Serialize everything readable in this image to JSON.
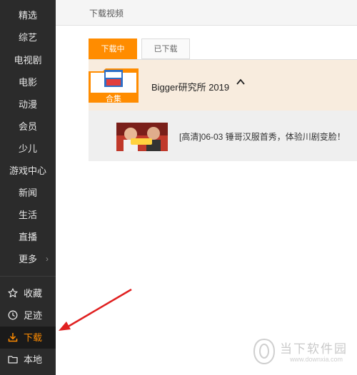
{
  "sidebar": {
    "items": [
      {
        "label": "精选"
      },
      {
        "label": "综艺"
      },
      {
        "label": "电视剧"
      },
      {
        "label": "电影"
      },
      {
        "label": "动漫"
      },
      {
        "label": "会员"
      },
      {
        "label": "少儿"
      },
      {
        "label": "游戏中心"
      },
      {
        "label": "新闻"
      },
      {
        "label": "生活"
      },
      {
        "label": "直播"
      },
      {
        "label": "更多"
      }
    ],
    "bottom": [
      {
        "label": "收藏",
        "icon": "star-icon"
      },
      {
        "label": "足迹",
        "icon": "clock-icon"
      },
      {
        "label": "下载",
        "icon": "download-icon",
        "active": true
      },
      {
        "label": "本地",
        "icon": "folder-icon"
      }
    ]
  },
  "header": {
    "title": "下载视频"
  },
  "tabs": [
    {
      "label": "下载中",
      "active": true
    },
    {
      "label": "已下载",
      "active": false
    }
  ],
  "collection": {
    "badge": "合集",
    "title": "Bigger研究所 2019"
  },
  "video": {
    "title": "[高清]06-03 锤哥汉服首秀，体验川剧变脸！"
  },
  "watermark": {
    "text": "当下软件园",
    "url": "www.downxia.com"
  },
  "colors": {
    "accent": "#ff8c00",
    "sidebar_bg": "#2b2b2b",
    "annotation_arrow": "#e02020"
  }
}
